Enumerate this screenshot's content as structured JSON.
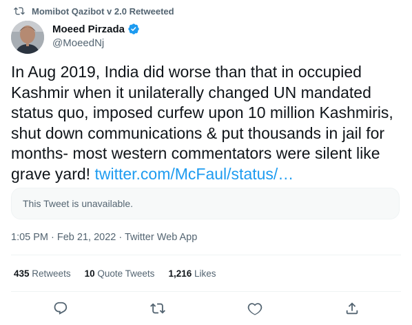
{
  "retweet_context": {
    "label": "Momibot Qazibot v 2.0 Retweeted"
  },
  "author": {
    "display_name": "Moeed Pirzada",
    "handle": "@MoeedNj",
    "verified": true
  },
  "tweet": {
    "text": "In Aug 2019, India did worse than that in occupied Kashmir when it unilaterally changed UN mandated status quo, imposed curfew upon 10 million Kashmiris, shut down communications & put thousands in jail for months- most western commentators were silent like grave yard! ",
    "link": "twitter.com/McFaul/status/…"
  },
  "quote": {
    "unavailable_text": "This Tweet is unavailable."
  },
  "meta": {
    "time": "1:05 PM",
    "separator_1": " · ",
    "date": "Feb 21, 2022",
    "separator_2": " · ",
    "source": "Twitter Web App"
  },
  "stats": {
    "retweets_count": "435",
    "retweets_label": "Retweets",
    "quote_count": "10",
    "quote_label": "Quote Tweets",
    "likes_count": "1,216",
    "likes_label": "Likes"
  },
  "colors": {
    "accent": "#1d9bf0",
    "secondary_text": "#536471",
    "primary_text": "#0f1419"
  },
  "icons": [
    "retweet-icon",
    "verified-badge-icon",
    "reply-icon",
    "retweet-action-icon",
    "like-icon",
    "share-icon"
  ]
}
